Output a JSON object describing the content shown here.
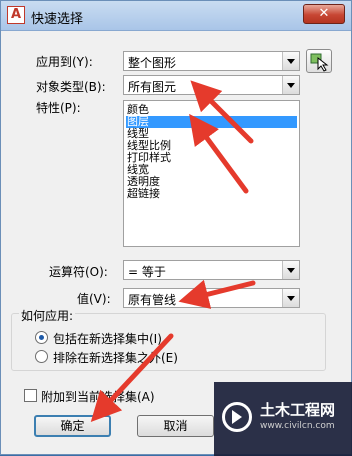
{
  "window": {
    "app_icon": "A",
    "title": "快速选择",
    "close_glyph": "✕"
  },
  "apply_to": {
    "label": "应用到(Y):",
    "value": "整个图形"
  },
  "object_type": {
    "label": "对象类型(B):",
    "value": "所有图元"
  },
  "properties": {
    "label": "特性(P):",
    "items": [
      "颜色",
      "图层",
      "线型",
      "线型比例",
      "打印样式",
      "线宽",
      "透明度",
      "超链接"
    ],
    "selected_index": 1
  },
  "operator": {
    "label": "运算符(O):",
    "value": "= 等于"
  },
  "value": {
    "label": "值(V):",
    "value": "原有管线"
  },
  "how_to_apply": {
    "title": "如何应用:",
    "options": [
      {
        "label": "包括在新选择集中(I)",
        "checked": true
      },
      {
        "label": "排除在新选择集之外(E)",
        "checked": false
      }
    ]
  },
  "append": {
    "label": "附加到当前选择集(A)",
    "checked": false
  },
  "buttons": {
    "ok": "确定",
    "cancel": "取消"
  },
  "watermark": {
    "name": "土木工程网",
    "url": "www.civilcn.com"
  },
  "colors": {
    "arrow": "#e53a2c",
    "selection": "#3399ff"
  }
}
